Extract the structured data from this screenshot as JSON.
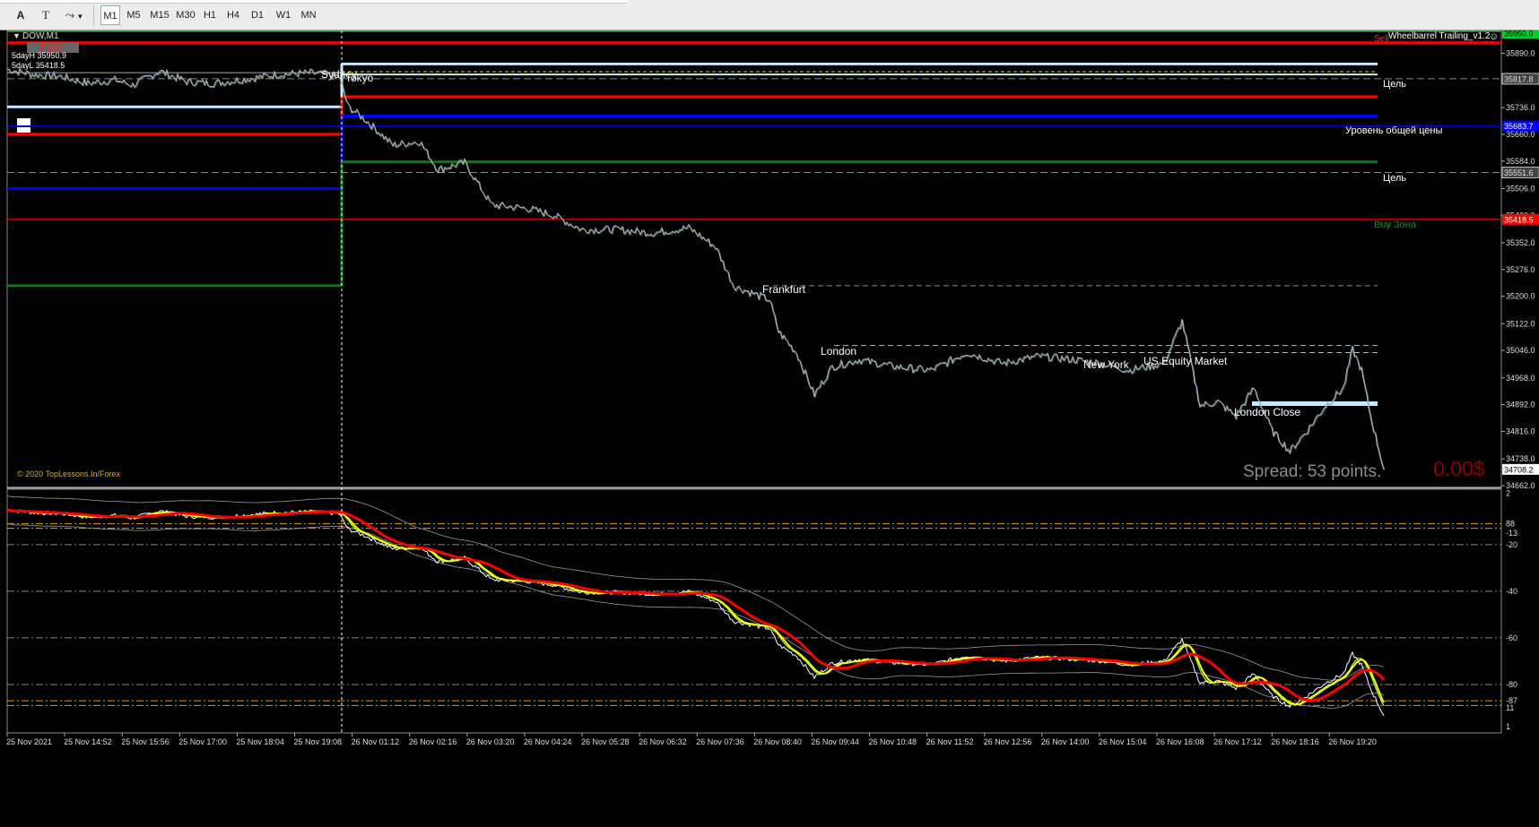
{
  "toolbar": {
    "tools": [
      "A",
      "T",
      "⤳"
    ],
    "timeframes": [
      "M1",
      "M5",
      "M15",
      "M30",
      "H1",
      "H4",
      "D1",
      "W1",
      "MN"
    ],
    "active_timeframe": "M1"
  },
  "chart": {
    "symbol_title": "DOW,M1",
    "fsr_label": "FSR",
    "five_day_high": "5dayH 35950.9",
    "five_day_low": "5dayL 35418.5",
    "ea_label": "Wheelbarrel Trailing_v1.2",
    "sell_label": "Sell",
    "target_label_1": "Цель",
    "target_label_2": "Цель",
    "common_price_label": "Уровень общей цены",
    "buy_zone_label": "Buy Зона",
    "copyright": "© 2020 TopLessons.In/Forex",
    "spread": "Spread: 53 points.",
    "profit": "0.00$",
    "sessions": {
      "sydney": "Sydney",
      "tokyo": "Tokyo",
      "frankfurt": "Frankfurt",
      "london": "London",
      "new_york": "New York",
      "us_equity": "US Equity Market",
      "london_close": "London Close"
    },
    "price_tags": {
      "top": "35950.9",
      "level_a": "35817.8",
      "blue": "35683.7",
      "level_b": "35551.6",
      "red": "35418.5",
      "current": "34708.2"
    },
    "colors": {
      "red": "#ff0000",
      "blue": "#0000ff",
      "green": "#008000",
      "light_blue": "#c8e6ff",
      "spread_gray": "#8c8c8c",
      "profit_red": "#8b0000",
      "copyright_gold": "#e0b000",
      "buy_green": "#00a000"
    }
  },
  "indicator": {
    "levels": [
      "2",
      "88",
      "-13",
      "-20",
      "-40",
      "-60",
      "-80",
      "-87",
      "11",
      "1"
    ]
  },
  "chart_data": {
    "type": "line",
    "title": "DOW,M1",
    "x_ticks": [
      "25 Nov 2021",
      "25 Nov 14:52",
      "25 Nov 15:56",
      "25 Nov 17:00",
      "25 Nov 18:04",
      "25 Nov 19:08",
      "26 Nov 01:12",
      "26 Nov 02:16",
      "26 Nov 03:20",
      "26 Nov 04:24",
      "26 Nov 05:28",
      "26 Nov 06:32",
      "26 Nov 07:36",
      "26 Nov 08:40",
      "26 Nov 09:44",
      "26 Nov 10:48",
      "26 Nov 11:52",
      "26 Nov 12:56",
      "26 Nov 14:00",
      "26 Nov 15:04",
      "26 Nov 16:08",
      "26 Nov 17:12",
      "26 Nov 18:16",
      "26 Nov 19:20"
    ],
    "y_ticks": [
      "35890.0",
      "35813.0",
      "35736.0",
      "35660.0",
      "35584.0",
      "35506.0",
      "35430.0",
      "35352.0",
      "35276.0",
      "35200.0",
      "35122.0",
      "35046.0",
      "34968.0",
      "34892.0",
      "34816.0",
      "34738.0",
      "34662.0"
    ],
    "ylim": [
      34662,
      35950
    ],
    "series": [
      {
        "points": [
          [
            0,
            35845
          ],
          [
            30,
            35830
          ],
          [
            60,
            35825
          ],
          [
            90,
            35805
          ],
          [
            120,
            35815
          ],
          [
            140,
            35800
          ],
          [
            170,
            35840
          ],
          [
            200,
            35810
          ],
          [
            230,
            35805
          ],
          [
            260,
            35815
          ],
          [
            300,
            35830
          ],
          [
            340,
            35835
          ],
          [
            370,
            35825
          ],
          [
            380,
            35740
          ],
          [
            400,
            35700
          ],
          [
            430,
            35630
          ],
          [
            460,
            35640
          ],
          [
            480,
            35560
          ],
          [
            510,
            35580
          ],
          [
            540,
            35460
          ],
          [
            580,
            35450
          ],
          [
            610,
            35430
          ],
          [
            640,
            35390
          ],
          [
            680,
            35390
          ],
          [
            720,
            35380
          ],
          [
            760,
            35395
          ],
          [
            790,
            35340
          ],
          [
            810,
            35230
          ],
          [
            830,
            35210
          ],
          [
            850,
            35190
          ],
          [
            860,
            35100
          ],
          [
            880,
            35040
          ],
          [
            900,
            34920
          ],
          [
            920,
            35000
          ],
          [
            950,
            35020
          ],
          [
            990,
            35000
          ],
          [
            1030,
            34990
          ],
          [
            1070,
            35040
          ],
          [
            1110,
            35010
          ],
          [
            1150,
            35030
          ],
          [
            1190,
            35020
          ],
          [
            1220,
            35010
          ],
          [
            1250,
            34990
          ],
          [
            1290,
            35010
          ],
          [
            1310,
            35130
          ],
          [
            1330,
            34890
          ],
          [
            1350,
            34900
          ],
          [
            1370,
            34860
          ],
          [
            1390,
            34940
          ],
          [
            1410,
            34820
          ],
          [
            1430,
            34760
          ],
          [
            1450,
            34820
          ],
          [
            1470,
            34890
          ],
          [
            1490,
            34940
          ],
          [
            1500,
            35050
          ],
          [
            1510,
            34990
          ],
          [
            1520,
            34860
          ],
          [
            1535,
            34708
          ]
        ]
      }
    ]
  }
}
